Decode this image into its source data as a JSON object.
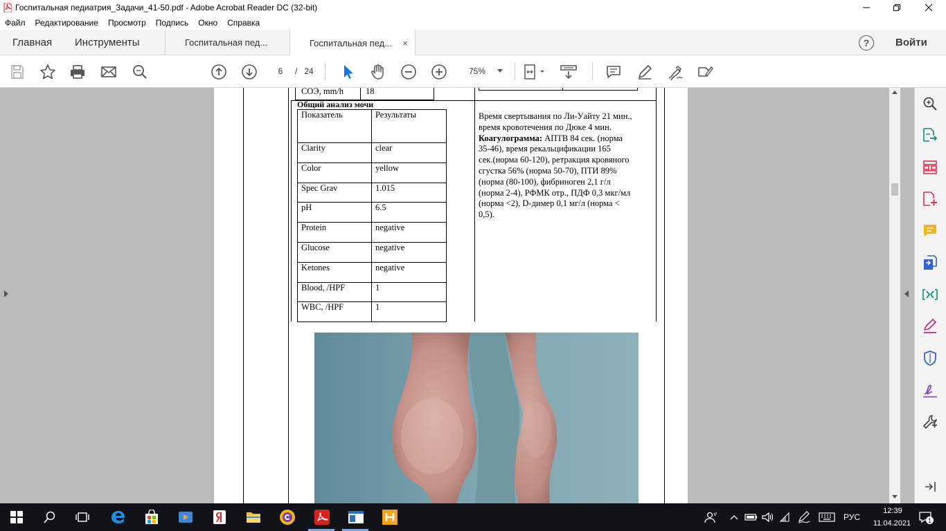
{
  "window": {
    "title": "Госпитальная педиатрия_Задачи_41-50.pdf - Adobe Acrobat Reader DC (32-bit)"
  },
  "menu": [
    "Файл",
    "Редактирование",
    "Просмотр",
    "Подпись",
    "Окно",
    "Справка"
  ],
  "tabs": {
    "home": "Главная",
    "tools": "Инструменты",
    "doc1": "Госпитальная пед...",
    "doc2": "Госпитальная пед...",
    "close": "×",
    "signin": "Войти",
    "help": "?"
  },
  "toolbar": {
    "page_current": "6",
    "page_sep": "/",
    "page_total": "24",
    "zoom": "75%"
  },
  "document": {
    "soe_label": "СОЭ, mm/h",
    "soe_value": "18",
    "urine_title": "Общий анализ мочи",
    "urine_headers": [
      "Показатель",
      "Результаты"
    ],
    "urine_rows": [
      [
        "Clarity",
        "clear"
      ],
      [
        "Color",
        "yellow"
      ],
      [
        "Spec Grav",
        "1.015"
      ],
      [
        "pH",
        "6.5"
      ],
      [
        "Protein",
        "negative"
      ],
      [
        "Glucose",
        "negative"
      ],
      [
        "Ketones",
        "negative"
      ],
      [
        "Blood, /HPF",
        "1"
      ],
      [
        "WBC, /HPF",
        "1"
      ]
    ],
    "coag_line1": "Время свертывания по Ли-Уайту 21 мин.,",
    "coag_line2": "время кровотечения по Дюке 4 мин.",
    "coag_bold": "Коагулограмма:",
    "coag_line3_rest": " АПТВ 84 сек. (норма",
    "coag_line4": "35-46), время рекальцификации 165",
    "coag_line5": "сек.(норма 60-120), ретракция кровяного",
    "coag_line6": "сгустка  56% (норма 50-70), ПТИ  89%",
    "coag_line7": "(норма (80-100), фибриноген 2,1 г/л",
    "coag_line8": "(норма 2-4), РФМК  отр., ПДФ 0,3 мкг/мл",
    "coag_line9": "(норма <2), D-димер 0,1 мг/л (норма <",
    "coag_line10": "0,5)."
  },
  "taskbar": {
    "lang": "РУС",
    "time": "12:39",
    "date": "11.04.2021",
    "notif_count": "1"
  },
  "colors": {
    "acrobat_red": "#d7221f",
    "taskbar_bg": "#101418",
    "workspace_bg": "#bbbbbb"
  }
}
